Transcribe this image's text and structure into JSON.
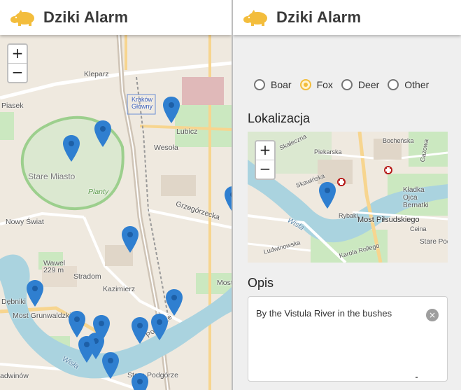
{
  "app": {
    "title": "Dziki Alarm",
    "accent": "#f3bd3c"
  },
  "left_map": {
    "zoom_in": "+",
    "zoom_out": "−",
    "labels": [
      "Kleparz",
      "Piasek",
      "Kraków Główny",
      "Lubicz",
      "Wesoła",
      "Stare Miasto",
      "Planty",
      "Nowy Świat",
      "Grzegórzecka",
      "Wawel",
      "229 m",
      "Stradom",
      "Kazimierz",
      "Most Grunwaldzki",
      "Podgórze",
      "Stare Podgórze",
      "Dębniki",
      "Wisła",
      "Most",
      "adwinów"
    ]
  },
  "form": {
    "animal_options": [
      {
        "label": "Boar",
        "selected": false
      },
      {
        "label": "Fox",
        "selected": true
      },
      {
        "label": "Deer",
        "selected": false
      },
      {
        "label": "Other",
        "selected": false
      }
    ],
    "location_heading": "Lokalizacja",
    "small_map": {
      "zoom_in": "+",
      "zoom_out": "−",
      "labels": [
        "Skałeczna",
        "Piekarska",
        "Skawińska",
        "Bocheńska",
        "Gazowa",
        "Kładka Ojca Bernatki",
        "Most Piłsudskiego",
        "Rybaki",
        "Wisła",
        "Ludwinowska",
        "Karola Rollego",
        "Ceina",
        "Stare Pod"
      ]
    },
    "description_heading": "Opis",
    "description_value": "By the Vistula River in the bushes",
    "clear_icon": "×"
  }
}
